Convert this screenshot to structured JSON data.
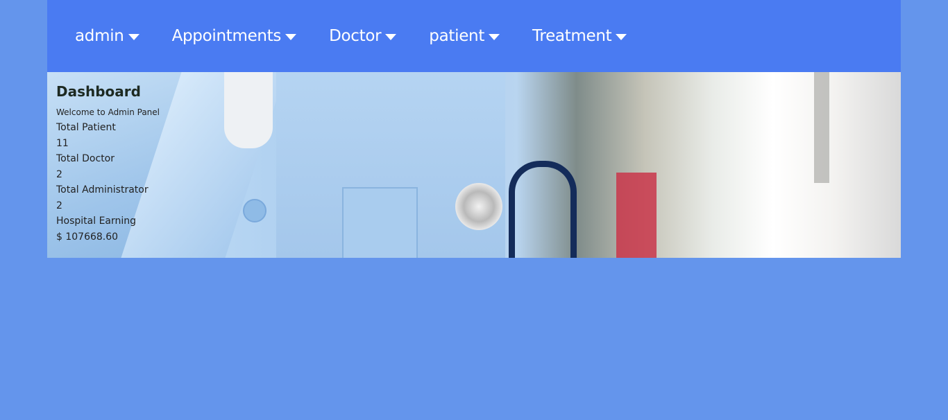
{
  "nav": {
    "items": [
      {
        "label": "admin",
        "icon": "caret-down-icon"
      },
      {
        "label": "Appointments",
        "icon": "caret-down-icon"
      },
      {
        "label": "Doctor",
        "icon": "caret-down-icon"
      },
      {
        "label": "patient",
        "icon": "caret-down-icon"
      },
      {
        "label": "Treatment",
        "icon": "caret-down-icon"
      }
    ]
  },
  "dashboard": {
    "title": "Dashboard",
    "welcome": "Welcome to Admin Panel",
    "stats": [
      {
        "label": "Total Patient",
        "value": "11"
      },
      {
        "label": "Total Doctor",
        "value": "2"
      },
      {
        "label": "Total Administrator",
        "value": "2"
      },
      {
        "label": "Hospital Earning",
        "value": "$ 107668.60"
      }
    ]
  },
  "colors": {
    "page_background": "#6495ec",
    "navbar_background": "#4a7bf2",
    "nav_text": "#ffffff"
  }
}
